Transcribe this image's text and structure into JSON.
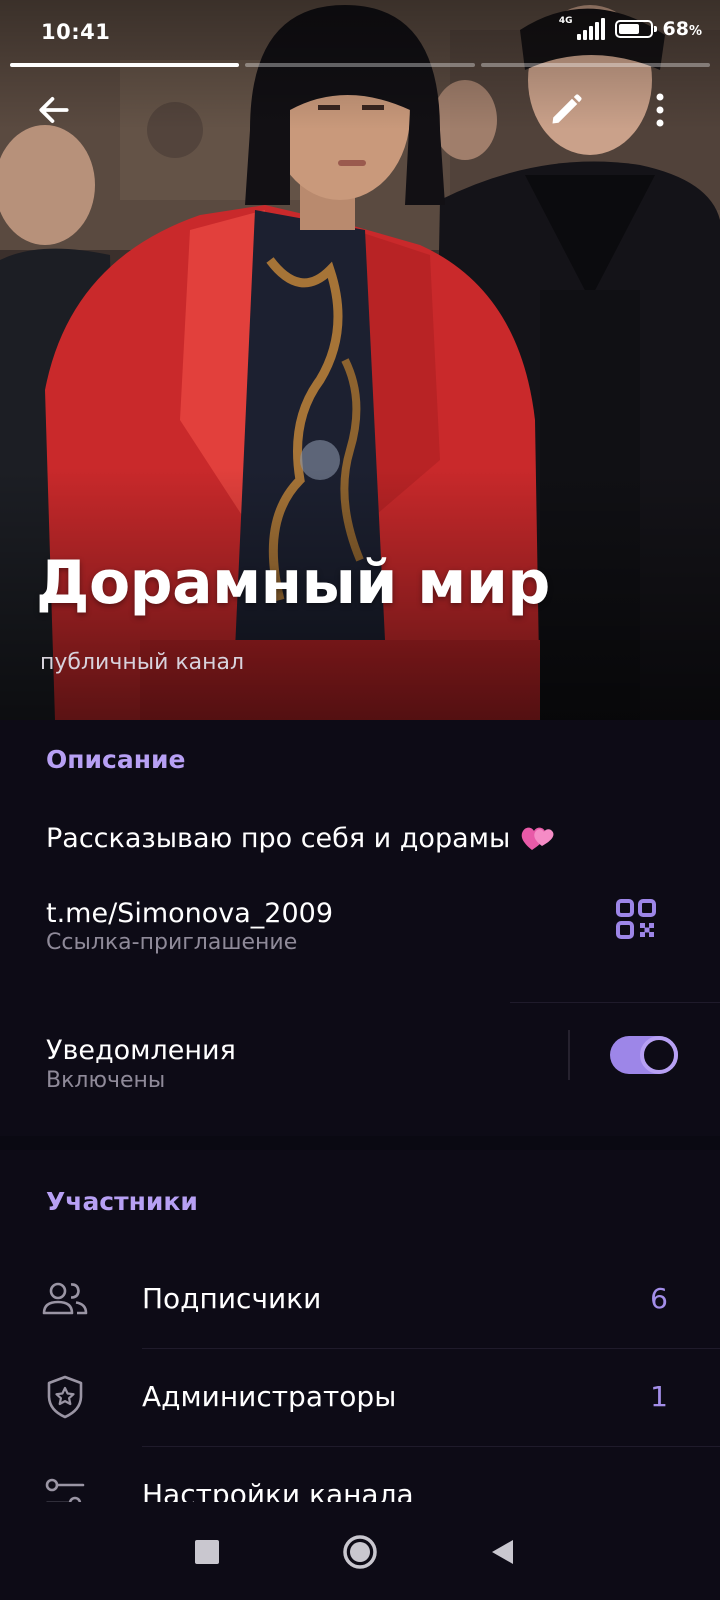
{
  "status_bar": {
    "time": "10:41",
    "network": "4G",
    "battery_percent": "68",
    "battery_unit": "%",
    "battery_level": 0.68
  },
  "story_progress": {
    "segments": 3,
    "active_index": 0
  },
  "channel": {
    "title": "Дорамный мир",
    "subtitle": "публичный канал"
  },
  "info": {
    "description_header": "Описание",
    "description": "Рассказываю про себя и дорамы",
    "description_emoji": "heart-icon",
    "invite_link": "t.me/Simonova_2009",
    "invite_link_caption": "Ссылка-приглашение"
  },
  "notifications": {
    "title": "Уведомления",
    "status": "Включены",
    "enabled": true
  },
  "members": {
    "header": "Участники",
    "items": [
      {
        "label": "Подписчики",
        "count": "6",
        "icon": "people-icon"
      },
      {
        "label": "Администраторы",
        "count": "1",
        "icon": "shield-star-icon"
      },
      {
        "label": "Настройки канала",
        "count": "",
        "icon": "settings-sliders-icon"
      }
    ]
  },
  "colors": {
    "accent": "#b7a0f4",
    "background": "#0d0b16",
    "secondary_text": "#8f8a99"
  }
}
